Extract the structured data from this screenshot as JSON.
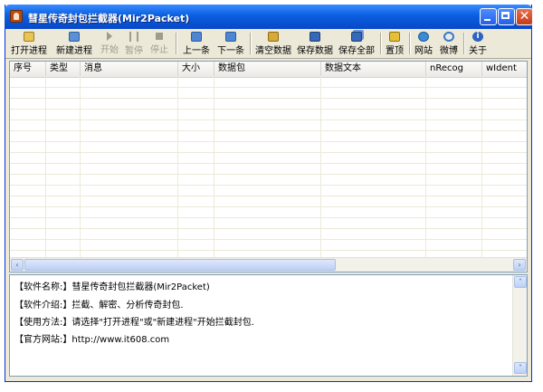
{
  "window": {
    "title": "彗星传奇封包拦截器(Mir2Packet)",
    "colors": {
      "titlebar": "#0a5fe0",
      "face": "#ece9d8",
      "close": "#c43b1a"
    }
  },
  "window_controls": {
    "close_glyph": "✕"
  },
  "toolbar": {
    "buttons": [
      {
        "label": "打开进程",
        "icon": "open-folder-icon",
        "enabled": true
      },
      {
        "label": "新建进程",
        "icon": "new-process-icon",
        "enabled": true
      },
      {
        "label": "开始",
        "icon": "play-icon",
        "enabled": false
      },
      {
        "label": "暂停",
        "icon": "pause-icon",
        "enabled": false
      },
      {
        "label": "停止",
        "icon": "stop-icon",
        "enabled": false
      },
      {
        "label": "上一条",
        "icon": "arrow-up-icon",
        "enabled": true
      },
      {
        "label": "下一条",
        "icon": "arrow-down-icon",
        "enabled": true
      },
      {
        "label": "清空数据",
        "icon": "broom-icon",
        "enabled": true
      },
      {
        "label": "保存数据",
        "icon": "floppy-disk-icon",
        "enabled": true
      },
      {
        "label": "保存全部",
        "icon": "floppy-disks-icon",
        "enabled": true
      },
      {
        "label": "置顶",
        "icon": "pin-icon",
        "enabled": true
      },
      {
        "label": "网站",
        "icon": "globe-icon",
        "enabled": true
      },
      {
        "label": "微博",
        "icon": "weibo-icon",
        "enabled": true
      },
      {
        "label": "关于",
        "icon": "info-icon",
        "enabled": true
      }
    ]
  },
  "grid": {
    "columns": [
      "序号",
      "类型",
      "消息",
      "大小",
      "数据包",
      "数据文本",
      "nRecog",
      "wIdent"
    ],
    "rows": []
  },
  "scrollbars": {
    "left_arrow": "‹",
    "right_arrow": "›",
    "up_arrow": "˄",
    "down_arrow": "˅"
  },
  "info": {
    "lines": [
      {
        "label": "【软件名称:】",
        "value": "彗星传奇封包拦截器(Mir2Packet)"
      },
      {
        "label": "【软件介绍:】",
        "value": "拦截、解密、分析传奇封包."
      },
      {
        "label": "【使用方法:】",
        "value": "请选择\"打开进程\"或\"新建进程\"开始拦截封包."
      },
      {
        "label": "【官方网站:】",
        "value": "http://www.it608.com"
      }
    ]
  }
}
